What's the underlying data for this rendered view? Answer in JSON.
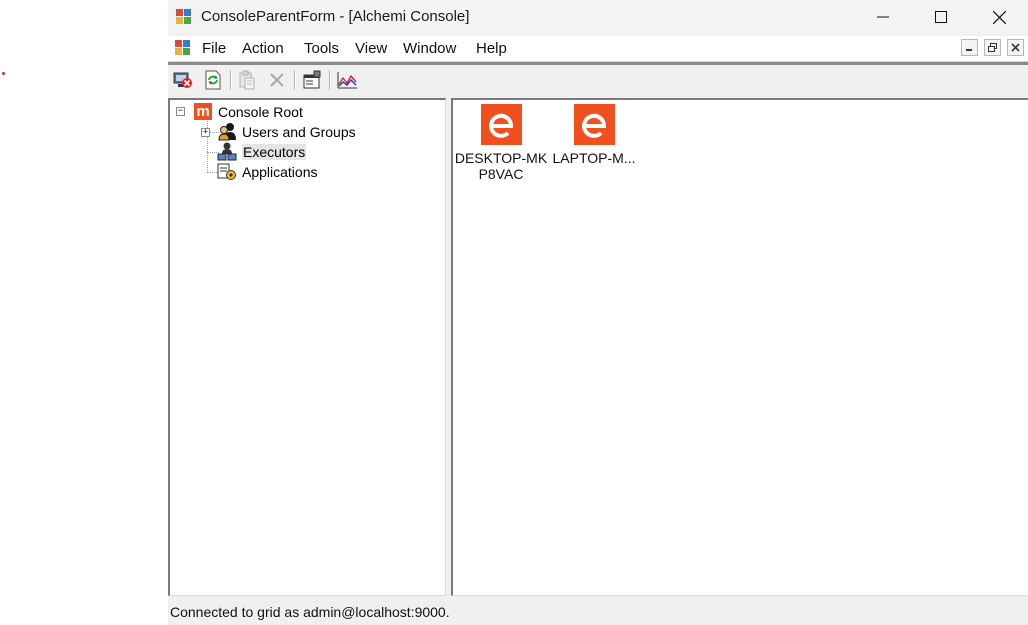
{
  "window": {
    "title": "ConsoleParentForm - [Alchemi Console]"
  },
  "menu": {
    "items": [
      "File",
      "Action",
      "Tools",
      "View",
      "Window",
      "Help"
    ]
  },
  "toolbar": {
    "buttons": [
      "disconnect-icon",
      "refresh-icon",
      "paste-icon",
      "delete-icon",
      "properties-icon",
      "chart-icon"
    ]
  },
  "tree": {
    "root": "Console Root",
    "children": [
      "Users and Groups",
      "Executors",
      "Applications"
    ],
    "selected": "Executors"
  },
  "executors": [
    {
      "label": "DESKTOP-MKP8VAC",
      "icon_letter": "e"
    },
    {
      "label": "LAPTOP-M...",
      "icon_letter": "e"
    }
  ],
  "status": {
    "text": "Connected to grid as admin@localhost:9000."
  },
  "colors": {
    "accent": "#f0501e",
    "selection": "#e5e5e5"
  }
}
